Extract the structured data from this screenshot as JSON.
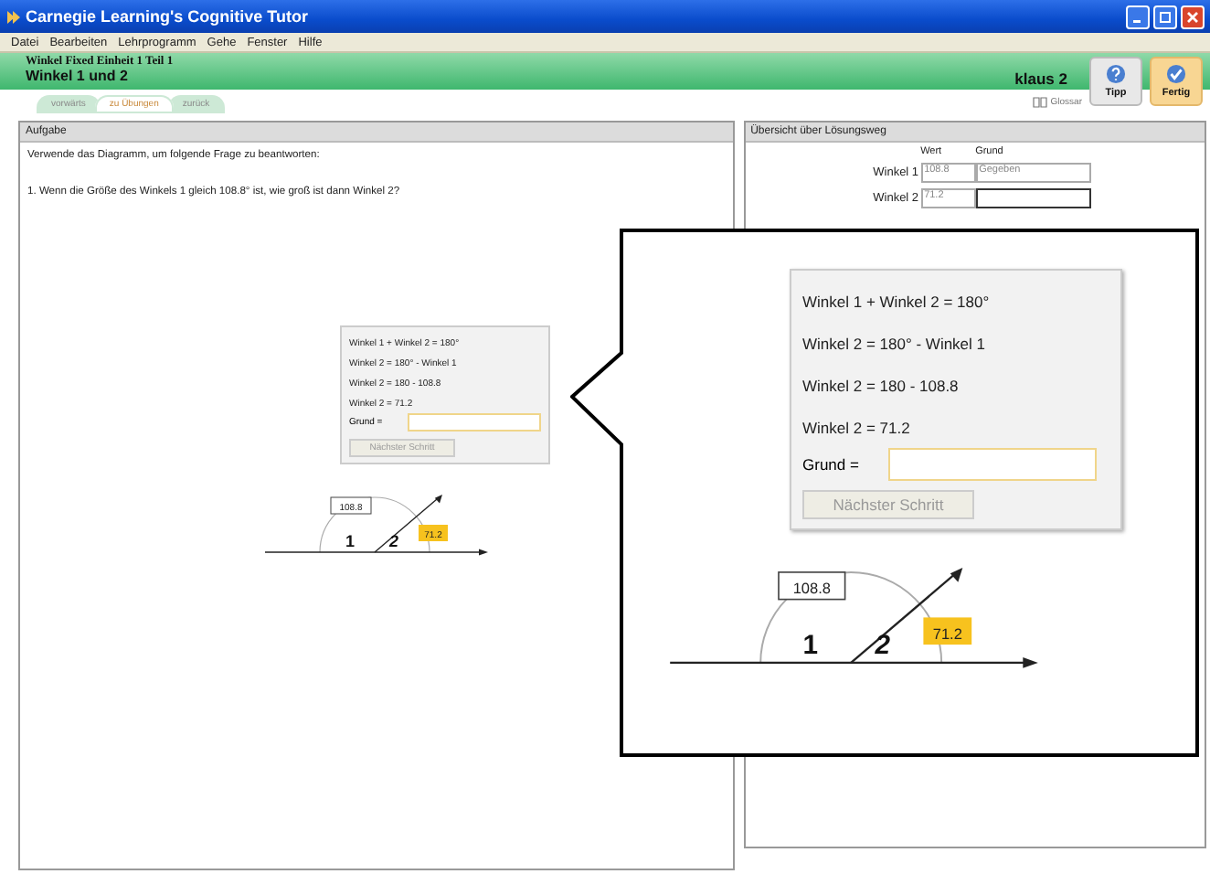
{
  "window": {
    "title": "Carnegie Learning's Cognitive Tutor"
  },
  "menu": [
    "Datei",
    "Bearbeiten",
    "Lehrprogramm",
    "Gehe",
    "Fenster",
    "Hilfe"
  ],
  "header": {
    "unit": "Winkel Fixed   Einheit 1 Teil 1",
    "title": "Winkel 1 und 2",
    "user": "klaus 2",
    "glossary": "Glossar"
  },
  "toolbar_buttons": [
    {
      "label": "Tipp",
      "kind": "hint"
    },
    {
      "label": "Fertig",
      "kind": "done"
    }
  ],
  "tabs": [
    {
      "label": "vorwärts",
      "selected": false
    },
    {
      "label": "zu Übungen",
      "selected": true
    },
    {
      "label": "zurück",
      "selected": false
    }
  ],
  "task": {
    "title": "Aufgabe",
    "intro": "Verwende das Diagramm, um folgende Frage zu beantworten:",
    "question": "1. Wenn die Größe des Winkels 1 gleich 108.8° ist, wie groß ist dann Winkel 2?"
  },
  "steps": {
    "lines": [
      "Winkel 1 + Winkel 2 = 180°",
      "Winkel 2 = 180° - Winkel 1",
      "Winkel 2 = 180 - 108.8",
      "Winkel 2 = 71.2"
    ],
    "reason_label": "Grund =",
    "next_button": "Nächster Schritt"
  },
  "diagram": {
    "angle_1_value": "108.8",
    "angle_2_value": "71.2",
    "label_1": "1",
    "label_2": "2"
  },
  "summary": {
    "title": "Übersicht über Lösungsweg",
    "columns": [
      "Wert",
      "Grund"
    ],
    "rows": [
      {
        "label": "Winkel 1",
        "value": "108.8",
        "reason": "Gegeben"
      },
      {
        "label": "Winkel 2",
        "value": "71.2"
      }
    ]
  },
  "magnified": {
    "steps": {
      "lines": [
        "Winkel 1 + Winkel 2 = 180°",
        "Winkel 2 = 180° - Winkel 1",
        "Winkel 2 = 180 - 108.8",
        "Winkel 2 = 71.2"
      ],
      "reason_label": "Grund =",
      "next_button": "Nächster Schritt"
    },
    "diagram": {
      "angle_1_value": "108.8",
      "angle_2_value": "71.2",
      "label_1": "1",
      "label_2": "2"
    }
  }
}
